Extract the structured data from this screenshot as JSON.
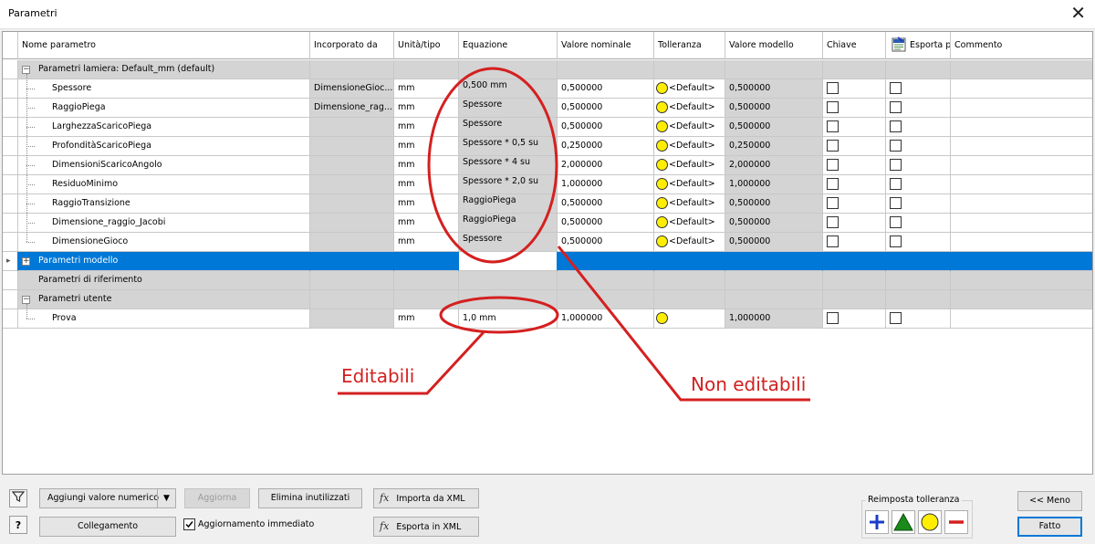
{
  "window": {
    "title": "Parametri",
    "close_glyph": "✕"
  },
  "columns": [
    "Nome parametro",
    "Incorporato da",
    "Unità/tipo",
    "Equazione",
    "Valore nominale",
    "Tolleranza",
    "Valore modello",
    "Chiave",
    "Esporta p",
    "Commento"
  ],
  "groups": {
    "lamiera": "Parametri lamiera: Default_mm (default)",
    "modello": "Parametri modello",
    "riferimento": "Parametri di riferimento",
    "utente": "Parametri utente"
  },
  "lamiera_rows": [
    {
      "name": "Spessore",
      "source": "DimensioneGioc...",
      "unit": "mm",
      "equation": "0,500 mm",
      "nominal": "0,500000",
      "tolerance": "<Default>",
      "model": "0,500000"
    },
    {
      "name": "RaggioPiega",
      "source": "Dimensione_rag...",
      "unit": "mm",
      "equation": "Spessore",
      "nominal": "0,500000",
      "tolerance": "<Default>",
      "model": "0,500000"
    },
    {
      "name": "LarghezzaScaricoPiega",
      "source": "",
      "unit": "mm",
      "equation": "Spessore",
      "nominal": "0,500000",
      "tolerance": "<Default>",
      "model": "0,500000"
    },
    {
      "name": "ProfonditàScaricoPiega",
      "source": "",
      "unit": "mm",
      "equation": "Spessore * 0,5 su",
      "nominal": "0,250000",
      "tolerance": "<Default>",
      "model": "0,250000"
    },
    {
      "name": "DimensioniScaricoAngolo",
      "source": "",
      "unit": "mm",
      "equation": "Spessore * 4 su",
      "nominal": "2,000000",
      "tolerance": "<Default>",
      "model": "2,000000"
    },
    {
      "name": "ResiduoMinimo",
      "source": "",
      "unit": "mm",
      "equation": "Spessore * 2,0 su",
      "nominal": "1,000000",
      "tolerance": "<Default>",
      "model": "1,000000"
    },
    {
      "name": "RaggioTransizione",
      "source": "",
      "unit": "mm",
      "equation": "RaggioPiega",
      "nominal": "0,500000",
      "tolerance": "<Default>",
      "model": "0,500000"
    },
    {
      "name": "Dimensione_raggio_Jacobi",
      "source": "",
      "unit": "mm",
      "equation": "RaggioPiega",
      "nominal": "0,500000",
      "tolerance": "<Default>",
      "model": "0,500000"
    },
    {
      "name": "DimensioneGioco",
      "source": "",
      "unit": "mm",
      "equation": "Spessore",
      "nominal": "0,500000",
      "tolerance": "<Default>",
      "model": "0,500000"
    }
  ],
  "user_row": {
    "name": "Prova",
    "source": "",
    "unit": "mm",
    "equation": "1,0 mm",
    "nominal": "1,000000",
    "tolerance": "",
    "model": "1,000000"
  },
  "annotations": {
    "editable": "Editabili",
    "non_editable": "Non editabili",
    "color": "#d42020"
  },
  "buttons": {
    "add_numeric": "Aggiungi valore numerico",
    "update": "Aggiorna",
    "delete_unused": "Elimina inutilizzati",
    "import_xml": "Importa da XML",
    "link": "Collegamento",
    "immediate_update": "Aggiornamento immediato",
    "export_xml": "Esporta in XML",
    "reset_tolerance": "Reimposta tolleranza",
    "less": "<< Meno",
    "done": "Fatto"
  },
  "colors": {
    "selection": "#0078d7",
    "readonly_cell": "#d4d4d4",
    "tolerance_dot": "#ffee00"
  }
}
